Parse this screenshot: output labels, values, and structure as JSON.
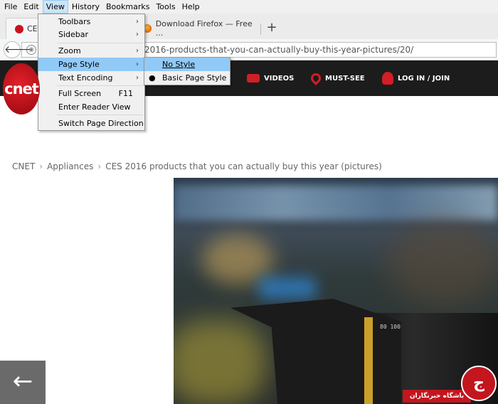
{
  "menubar": {
    "file": "File",
    "edit": "Edit",
    "view": "View",
    "history": "History",
    "bookmarks": "Bookmarks",
    "tools": "Tools",
    "help": "Help"
  },
  "tabs": {
    "tab1_title": "CES",
    "tab2_title": "Download Firefox — Free ...",
    "new_tab": "+"
  },
  "url": "2016-products-that-you-can-actually-buy-this-year-pictures/20/",
  "cnet": {
    "logo": "cnet",
    "nav": {
      "videos": "VIDEOS",
      "must_see": "MUST-SEE",
      "login": "LOG IN / JOIN"
    }
  },
  "breadcrumb": {
    "home": "CNET",
    "section": "Appliances",
    "page": "CES 2016 products that you can actually buy this year (pictures)"
  },
  "view_menu": {
    "toolbars": "Toolbars",
    "sidebar": "Sidebar",
    "zoom": "Zoom",
    "page_style": "Page Style",
    "text_encoding": "Text Encoding",
    "full_screen": "Full Screen",
    "full_screen_shortcut": "F11",
    "reader_view": "Enter Reader View",
    "switch_direction": "Switch Page Direction"
  },
  "page_style_menu": {
    "no_style": "No Style",
    "basic_style": "Basic Page Style"
  },
  "lens_text": "80  100  ",
  "watermark": {
    "text": "باشگاه خبرنگاران"
  },
  "colors": {
    "cnet_red": "#c9141d",
    "menu_highlight": "#91c9f7",
    "header_bg": "#1c1c1c"
  }
}
